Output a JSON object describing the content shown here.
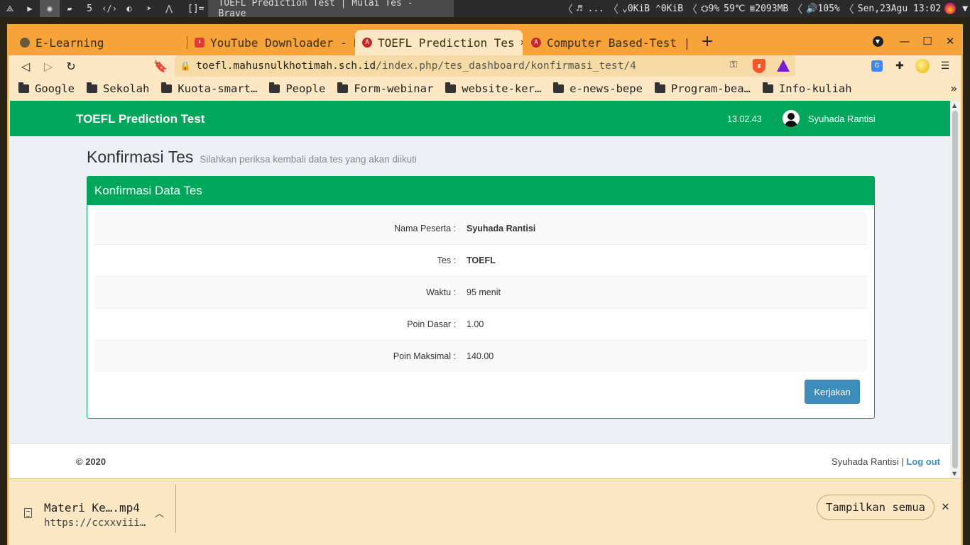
{
  "sysbar": {
    "workspace_count": "5",
    "layout": "[]=",
    "window_title": "TOEFL Prediction Test | Mulai Tes - Brave",
    "media": "♬ ...",
    "net": "⌄0KiB ⌃0KiB",
    "cpu": "⛭9%",
    "temp": "59℃",
    "mem": "≣2093MB",
    "vol": "🔊105%",
    "datetime": "Sen,23Agu 13:02"
  },
  "tabs": [
    {
      "label": "E-Learning"
    },
    {
      "label": "YouTube Downloader - Do"
    },
    {
      "label": "TOEFL Prediction Tes"
    },
    {
      "label": "Computer Based-Test | "
    }
  ],
  "url": {
    "host": "toefl.mahusnulkhotimah.sch.id",
    "path": "/index.php/tes_dashboard/konfirmasi_test/4"
  },
  "bookmarks": [
    "Google",
    "Sekolah",
    "Kuota-smart…",
    "People",
    "Form-webinar",
    "website-ker…",
    "e-news-bepe",
    "Program-bea…",
    "Info-kuliah"
  ],
  "page": {
    "brand": "TOEFL Prediction Test",
    "clock": "13.02.43",
    "user": "Syuhada Rantisi",
    "title": "Konfirmasi Tes",
    "subtitle": "Silahkan periksa kembali data tes yang akan diikuti",
    "box_title": "Konfirmasi Data Tes",
    "rows": [
      {
        "label": "Nama Peserta :",
        "value": "Syuhada Rantisi"
      },
      {
        "label": "Tes :",
        "value": "TOEFL"
      },
      {
        "label": "Waktu :",
        "value": "95 menit"
      },
      {
        "label": "Poin Dasar :",
        "value": "1.00"
      },
      {
        "label": "Poin Maksimal :",
        "value": "140.00"
      }
    ],
    "button": "Kerjakan",
    "copyright": "© 2020",
    "footer_user": "Syuhada Rantisi",
    "footer_sep": "|",
    "logout": "Log out"
  },
  "downloads": {
    "file_name": "Materi Ke….mp4",
    "file_url": "https://ccxxviii…",
    "show_all": "Tampilkan semua"
  }
}
